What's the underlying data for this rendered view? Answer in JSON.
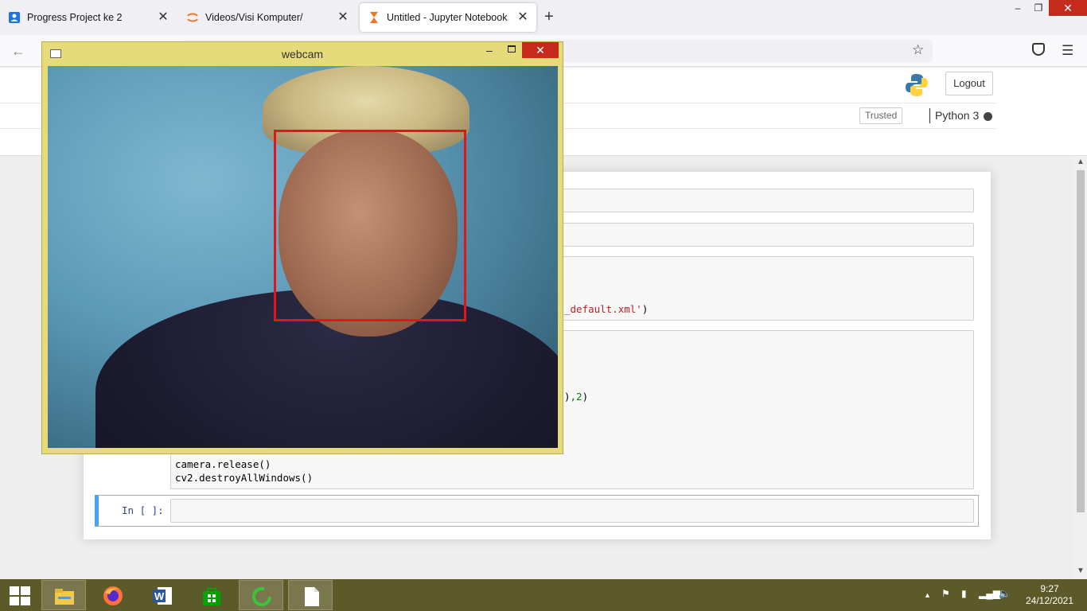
{
  "browser": {
    "tabs": [
      {
        "title": "Progress Project ke 2",
        "icon": "account-icon",
        "active": false
      },
      {
        "title": "Videos/Visi Komputer/",
        "icon": "jupyter-icon",
        "active": false
      },
      {
        "title": "Untitled - Jupyter Notebook",
        "icon": "hourglass-icon",
        "active": true
      }
    ],
    "new_tab": "+",
    "close_glyph": "✕"
  },
  "jupyter": {
    "logout_label": "Logout",
    "trusted_label": "Trusted",
    "kernel_label": "Python 3"
  },
  "notebook": {
    "visible_code": {
      "line_a_str": "_default.xml'",
      "line_a_end": ")",
      "line_b_pre": ")",
      "line_b_num": ",2",
      "line_b_end": ")",
      "release": "camera.release()",
      "destroy": "cv2.destroyAllWindows()"
    },
    "empty_prompt": "In [ ]:"
  },
  "webcam_window": {
    "title": "webcam",
    "close_glyph": "✕",
    "min_glyph": "–"
  },
  "taskbar": {
    "time": "9:27",
    "date": "24/12/2021",
    "apps": [
      "file-explorer-icon",
      "firefox-icon",
      "word-icon",
      "store-icon",
      "loading-app-icon",
      "blank-document-icon"
    ]
  },
  "colors": {
    "taskbar": "#5d5a29",
    "webcam_frame": "#e6da7a",
    "face_box": "#e2151b",
    "cell_selected": "#42a5f5"
  }
}
